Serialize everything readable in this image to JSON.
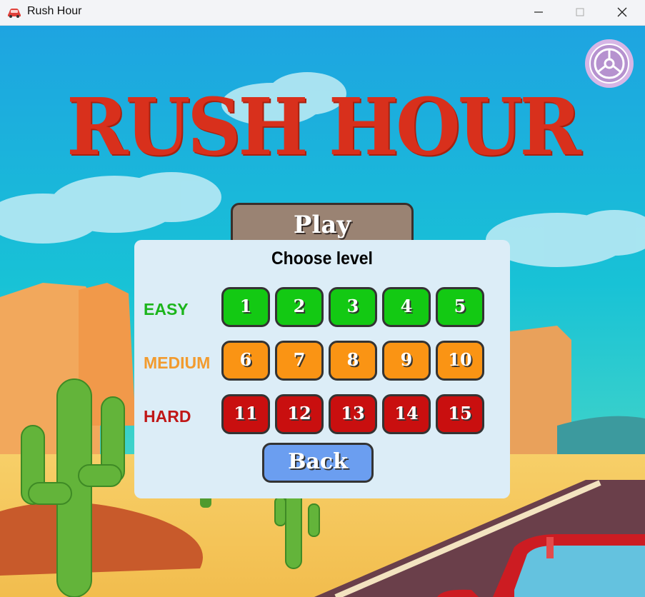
{
  "window": {
    "title": "Rush Hour",
    "minimize_symbol": "—",
    "maximize_symbol": "☐",
    "close_symbol": "✕"
  },
  "game": {
    "title": "RUSH HOUR",
    "settings_icon": "gear-icon",
    "play_label": "Play"
  },
  "level_select": {
    "title": "Choose level",
    "rows": [
      {
        "label": "EASY",
        "color": "#1cb51c",
        "levels": [
          "1",
          "2",
          "3",
          "4",
          "5"
        ]
      },
      {
        "label": "MEDIUM",
        "color": "#f29b2e",
        "levels": [
          "6",
          "7",
          "8",
          "9",
          "10"
        ]
      },
      {
        "label": "HARD",
        "color": "#c01717",
        "levels": [
          "11",
          "12",
          "13",
          "14",
          "15"
        ]
      }
    ],
    "back_label": "Back"
  }
}
